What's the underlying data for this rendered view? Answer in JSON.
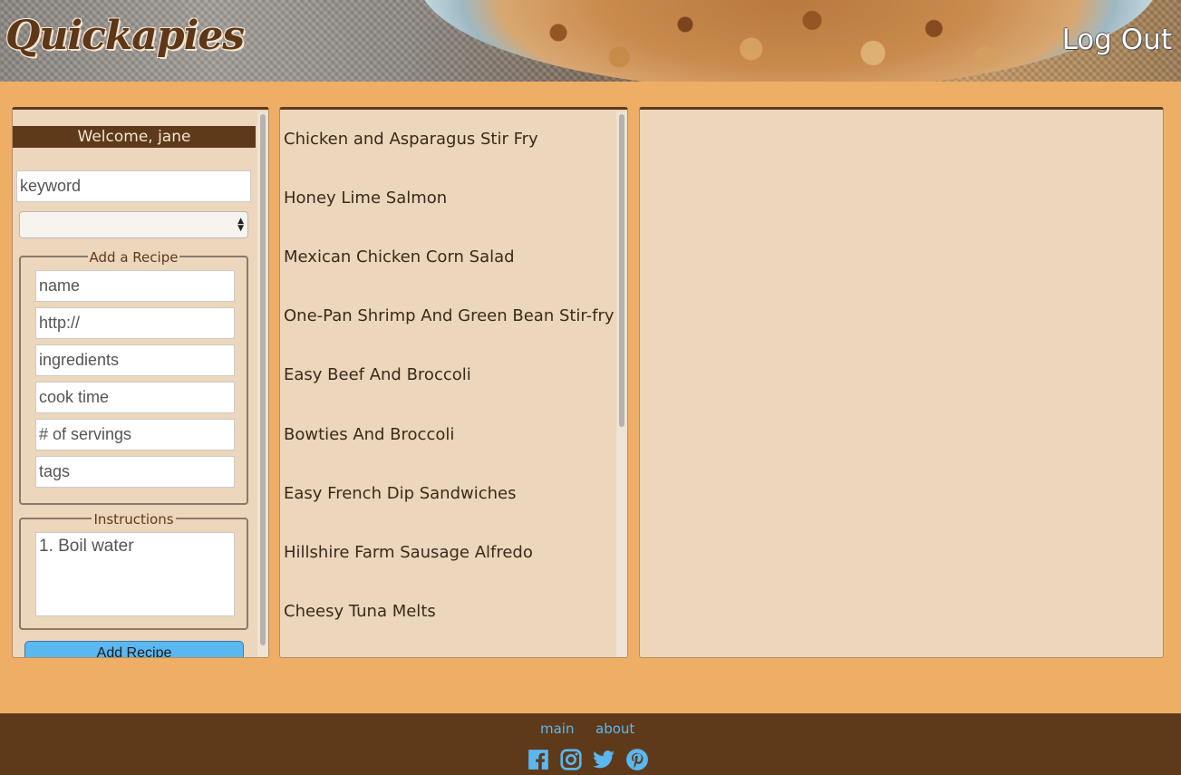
{
  "header": {
    "logo": "Quickapies",
    "logout_label": "Log Out"
  },
  "sidebar": {
    "welcome": "Welcome, jane",
    "keyword_placeholder": "keyword",
    "category_selected": "",
    "add_recipe": {
      "legend": "Add a Recipe",
      "name_placeholder": "name",
      "url_placeholder": "http://",
      "ingredients_placeholder": "ingredients",
      "cook_time_placeholder": "cook time",
      "servings_placeholder": "# of servings",
      "tags_placeholder": "tags"
    },
    "instructions": {
      "legend": "Instructions",
      "placeholder": "1. Boil water"
    },
    "add_button": "Add Recipe"
  },
  "recipes": [
    "Chicken and Asparagus Stir Fry",
    "Honey Lime Salmon",
    "Mexican Chicken Corn Salad",
    "One-Pan Shrimp And Green Bean Stir-fry",
    "Easy Beef And Broccoli",
    "Bowties And Broccoli",
    "Easy French Dip Sandwiches",
    "Hillshire Farm Sausage Alfredo",
    "Cheesy Tuna Melts"
  ],
  "footer": {
    "links": [
      "main",
      "about"
    ],
    "social_icons": [
      "facebook-icon",
      "instagram-icon",
      "twitter-icon",
      "pinterest-icon"
    ],
    "accent_color": "#5bb7ef"
  },
  "colors": {
    "background": "#efae66",
    "panel": "#ecd6bc",
    "brown": "#5e3a1b"
  }
}
